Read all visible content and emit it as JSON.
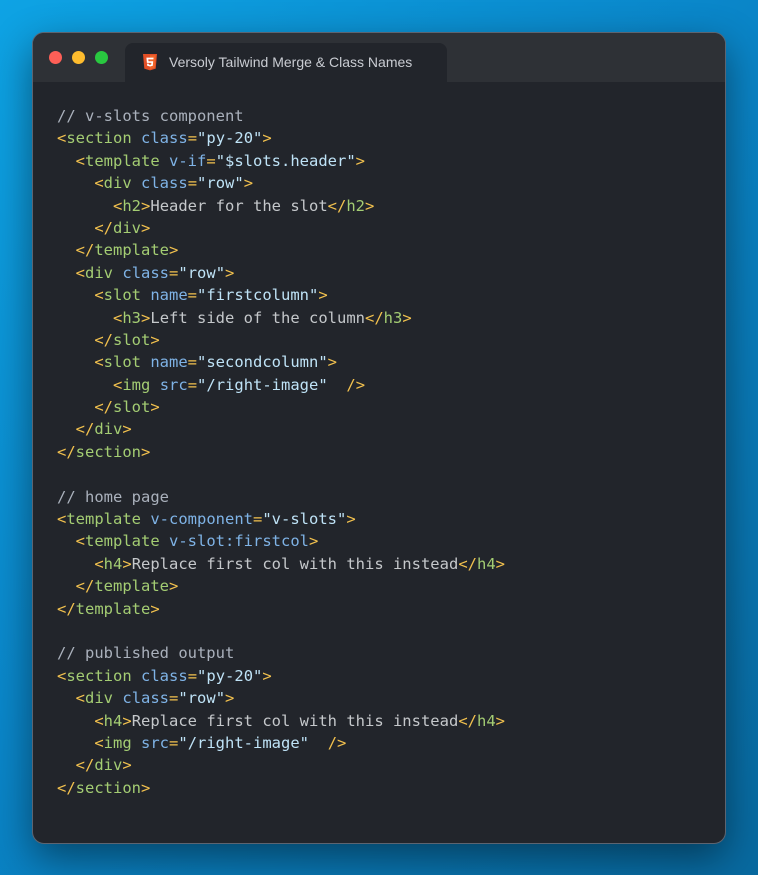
{
  "window": {
    "controls": [
      "close",
      "minimize",
      "maximize"
    ],
    "tab": {
      "icon": "html5-icon",
      "title": "Versoly Tailwind Merge & Class Names"
    }
  },
  "colors": {
    "comment": "#aab1bc",
    "tag": "#a4cd73",
    "punct": "#f2c14e",
    "attr": "#7fb3e6",
    "string": "#bfe3f7",
    "text": "#c5c8cb"
  },
  "code": [
    [
      [
        "c",
        "// v-slots component"
      ]
    ],
    [
      [
        "p",
        "<"
      ],
      [
        "t",
        "section"
      ],
      [
        "s",
        " "
      ],
      [
        "a",
        "class"
      ],
      [
        "p",
        "="
      ],
      [
        "v",
        "\"py-20\""
      ],
      [
        "p",
        ">"
      ]
    ],
    [
      [
        "s",
        "  "
      ],
      [
        "p",
        "<"
      ],
      [
        "t",
        "template"
      ],
      [
        "s",
        " "
      ],
      [
        "a",
        "v-if"
      ],
      [
        "p",
        "="
      ],
      [
        "v",
        "\"$slots.header\""
      ],
      [
        "p",
        ">"
      ]
    ],
    [
      [
        "s",
        "    "
      ],
      [
        "p",
        "<"
      ],
      [
        "t",
        "div"
      ],
      [
        "s",
        " "
      ],
      [
        "a",
        "class"
      ],
      [
        "p",
        "="
      ],
      [
        "v",
        "\"row\""
      ],
      [
        "p",
        ">"
      ]
    ],
    [
      [
        "s",
        "      "
      ],
      [
        "p",
        "<"
      ],
      [
        "t",
        "h2"
      ],
      [
        "p",
        ">"
      ],
      [
        "x",
        "Header for the slot"
      ],
      [
        "p",
        "</"
      ],
      [
        "t",
        "h2"
      ],
      [
        "p",
        ">"
      ]
    ],
    [
      [
        "s",
        "    "
      ],
      [
        "p",
        "</"
      ],
      [
        "t",
        "div"
      ],
      [
        "p",
        ">"
      ]
    ],
    [
      [
        "s",
        "  "
      ],
      [
        "p",
        "</"
      ],
      [
        "t",
        "template"
      ],
      [
        "p",
        ">"
      ]
    ],
    [
      [
        "s",
        "  "
      ],
      [
        "p",
        "<"
      ],
      [
        "t",
        "div"
      ],
      [
        "s",
        " "
      ],
      [
        "a",
        "class"
      ],
      [
        "p",
        "="
      ],
      [
        "v",
        "\"row\""
      ],
      [
        "p",
        ">"
      ]
    ],
    [
      [
        "s",
        "    "
      ],
      [
        "p",
        "<"
      ],
      [
        "t",
        "slot"
      ],
      [
        "s",
        " "
      ],
      [
        "a",
        "name"
      ],
      [
        "p",
        "="
      ],
      [
        "v",
        "\"firstcolumn\""
      ],
      [
        "p",
        ">"
      ]
    ],
    [
      [
        "s",
        "      "
      ],
      [
        "p",
        "<"
      ],
      [
        "t",
        "h3"
      ],
      [
        "p",
        ">"
      ],
      [
        "x",
        "Left side of the column"
      ],
      [
        "p",
        "</"
      ],
      [
        "t",
        "h3"
      ],
      [
        "p",
        ">"
      ]
    ],
    [
      [
        "s",
        "    "
      ],
      [
        "p",
        "</"
      ],
      [
        "t",
        "slot"
      ],
      [
        "p",
        ">"
      ]
    ],
    [
      [
        "s",
        "    "
      ],
      [
        "p",
        "<"
      ],
      [
        "t",
        "slot"
      ],
      [
        "s",
        " "
      ],
      [
        "a",
        "name"
      ],
      [
        "p",
        "="
      ],
      [
        "v",
        "\"secondcolumn\""
      ],
      [
        "p",
        ">"
      ]
    ],
    [
      [
        "s",
        "      "
      ],
      [
        "p",
        "<"
      ],
      [
        "t",
        "img"
      ],
      [
        "s",
        " "
      ],
      [
        "a",
        "src"
      ],
      [
        "p",
        "="
      ],
      [
        "v",
        "\"/right-image\""
      ],
      [
        "s",
        "  "
      ],
      [
        "p",
        "/>"
      ]
    ],
    [
      [
        "s",
        "    "
      ],
      [
        "p",
        "</"
      ],
      [
        "t",
        "slot"
      ],
      [
        "p",
        ">"
      ]
    ],
    [
      [
        "s",
        "  "
      ],
      [
        "p",
        "</"
      ],
      [
        "t",
        "div"
      ],
      [
        "p",
        ">"
      ]
    ],
    [
      [
        "p",
        "</"
      ],
      [
        "t",
        "section"
      ],
      [
        "p",
        ">"
      ]
    ],
    [],
    [
      [
        "c",
        "// home page"
      ]
    ],
    [
      [
        "p",
        "<"
      ],
      [
        "t",
        "template"
      ],
      [
        "s",
        " "
      ],
      [
        "a",
        "v-component"
      ],
      [
        "p",
        "="
      ],
      [
        "v",
        "\"v-slots\""
      ],
      [
        "p",
        ">"
      ]
    ],
    [
      [
        "s",
        "  "
      ],
      [
        "p",
        "<"
      ],
      [
        "t",
        "template"
      ],
      [
        "s",
        " "
      ],
      [
        "a",
        "v-slot:firstcol"
      ],
      [
        "p",
        ">"
      ]
    ],
    [
      [
        "s",
        "    "
      ],
      [
        "p",
        "<"
      ],
      [
        "t",
        "h4"
      ],
      [
        "p",
        ">"
      ],
      [
        "x",
        "Replace first col with this instead"
      ],
      [
        "p",
        "</"
      ],
      [
        "t",
        "h4"
      ],
      [
        "p",
        ">"
      ]
    ],
    [
      [
        "s",
        "  "
      ],
      [
        "p",
        "</"
      ],
      [
        "t",
        "template"
      ],
      [
        "p",
        ">"
      ]
    ],
    [
      [
        "p",
        "</"
      ],
      [
        "t",
        "template"
      ],
      [
        "p",
        ">"
      ]
    ],
    [],
    [
      [
        "c",
        "// published output"
      ]
    ],
    [
      [
        "p",
        "<"
      ],
      [
        "t",
        "section"
      ],
      [
        "s",
        " "
      ],
      [
        "a",
        "class"
      ],
      [
        "p",
        "="
      ],
      [
        "v",
        "\"py-20\""
      ],
      [
        "p",
        ">"
      ]
    ],
    [
      [
        "s",
        "  "
      ],
      [
        "p",
        "<"
      ],
      [
        "t",
        "div"
      ],
      [
        "s",
        " "
      ],
      [
        "a",
        "class"
      ],
      [
        "p",
        "="
      ],
      [
        "v",
        "\"row\""
      ],
      [
        "p",
        ">"
      ]
    ],
    [
      [
        "s",
        "    "
      ],
      [
        "p",
        "<"
      ],
      [
        "t",
        "h4"
      ],
      [
        "p",
        ">"
      ],
      [
        "x",
        "Replace first col with this instead"
      ],
      [
        "p",
        "</"
      ],
      [
        "t",
        "h4"
      ],
      [
        "p",
        ">"
      ]
    ],
    [
      [
        "s",
        "    "
      ],
      [
        "p",
        "<"
      ],
      [
        "t",
        "img"
      ],
      [
        "s",
        " "
      ],
      [
        "a",
        "src"
      ],
      [
        "p",
        "="
      ],
      [
        "v",
        "\"/right-image\""
      ],
      [
        "s",
        "  "
      ],
      [
        "p",
        "/>"
      ]
    ],
    [
      [
        "s",
        "  "
      ],
      [
        "p",
        "</"
      ],
      [
        "t",
        "div"
      ],
      [
        "p",
        ">"
      ]
    ],
    [
      [
        "p",
        "</"
      ],
      [
        "t",
        "section"
      ],
      [
        "p",
        ">"
      ]
    ]
  ]
}
